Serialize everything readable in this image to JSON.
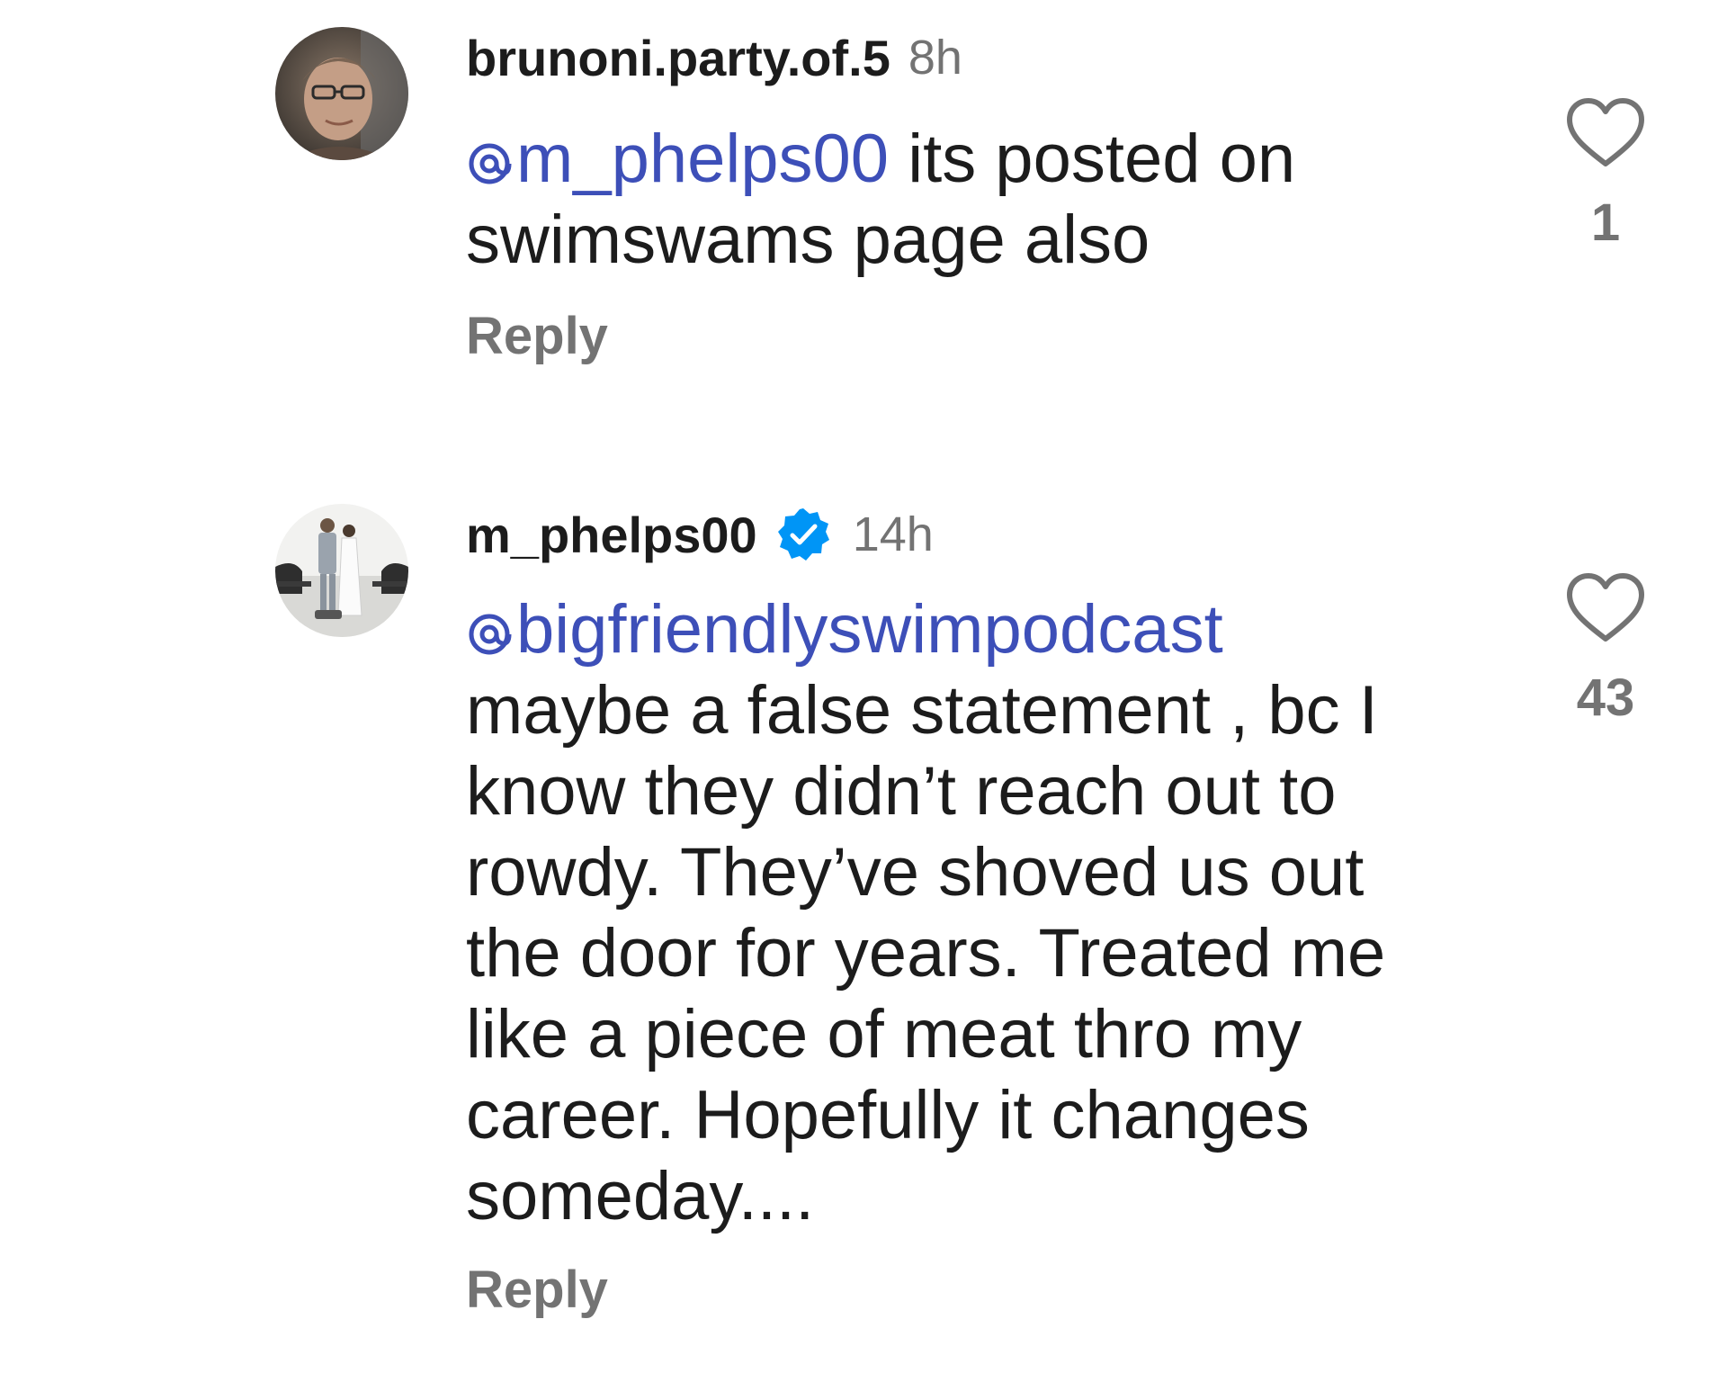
{
  "comments": [
    {
      "username": "brunoni.party.of.5",
      "verified": false,
      "time": "8h",
      "mention": "m_phelps00",
      "text": " its posted on\nswimswams page also",
      "reply_label": "Reply",
      "like_count": "1",
      "avatar_icon": "profile-photo-person"
    },
    {
      "username": "m_phelps00",
      "verified": true,
      "time": "14h",
      "mention": "bigfriendlyswimpodcast",
      "text": "\nmaybe a false statement , bc I\nknow they didn’t reach out to\nrowdy.  They’ve shoved us out\nthe door for years.  Treated me\nlike a piece of meat thro my\ncareer.  Hopefully it changes\nsomeday....",
      "reply_label": "Reply",
      "like_count": "43",
      "avatar_icon": "profile-photo-wedding"
    }
  ],
  "colors": {
    "mention": "#3d4fb8",
    "secondary_text": "#737373",
    "verified_badge": "#0095f6"
  },
  "icons": {
    "like": "heart-outline-icon",
    "verified": "verified-badge-icon",
    "mention": "at-sign-icon"
  }
}
